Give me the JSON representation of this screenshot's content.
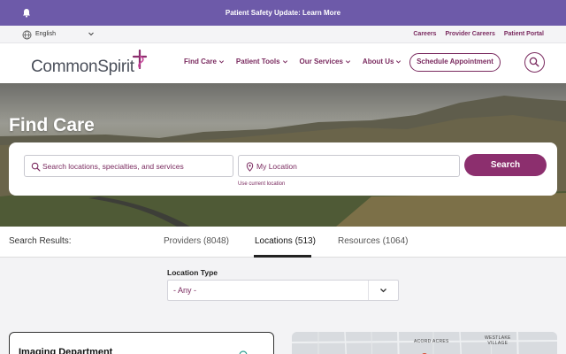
{
  "announcement": {
    "text": "Patient Safety Update: Learn More",
    "icon": "bell-icon"
  },
  "utility": {
    "language": "English",
    "links": [
      "Careers",
      "Provider Careers",
      "Patient Portal"
    ]
  },
  "nav": {
    "logo_text": "CommonSpirit",
    "menu": [
      "Find Care",
      "Patient Tools",
      "Our Services",
      "About Us"
    ],
    "schedule_label": "Schedule Appointment"
  },
  "hero": {
    "title": "Find Care",
    "keyword_placeholder": "Search locations, specialties, and services",
    "location_placeholder": "My Location",
    "use_current_location": "Use current location",
    "search_label": "Search"
  },
  "results": {
    "label": "Search Results:",
    "tabs": [
      "Providers (8048)",
      "Locations (513)",
      "Resources (1064)"
    ],
    "active_tab": "Locations (513)"
  },
  "filter": {
    "label": "Location Type",
    "selected": "- Any -"
  },
  "card": {
    "title": "Imaging Department"
  },
  "map": {
    "labels": [
      "ACORD ACRES",
      "WESTLAKE",
      "VILLAGE"
    ]
  },
  "colors": {
    "brand": "#7a2a5f",
    "announce_bg": "#6d5aa9",
    "button": "#8c2f6e"
  }
}
